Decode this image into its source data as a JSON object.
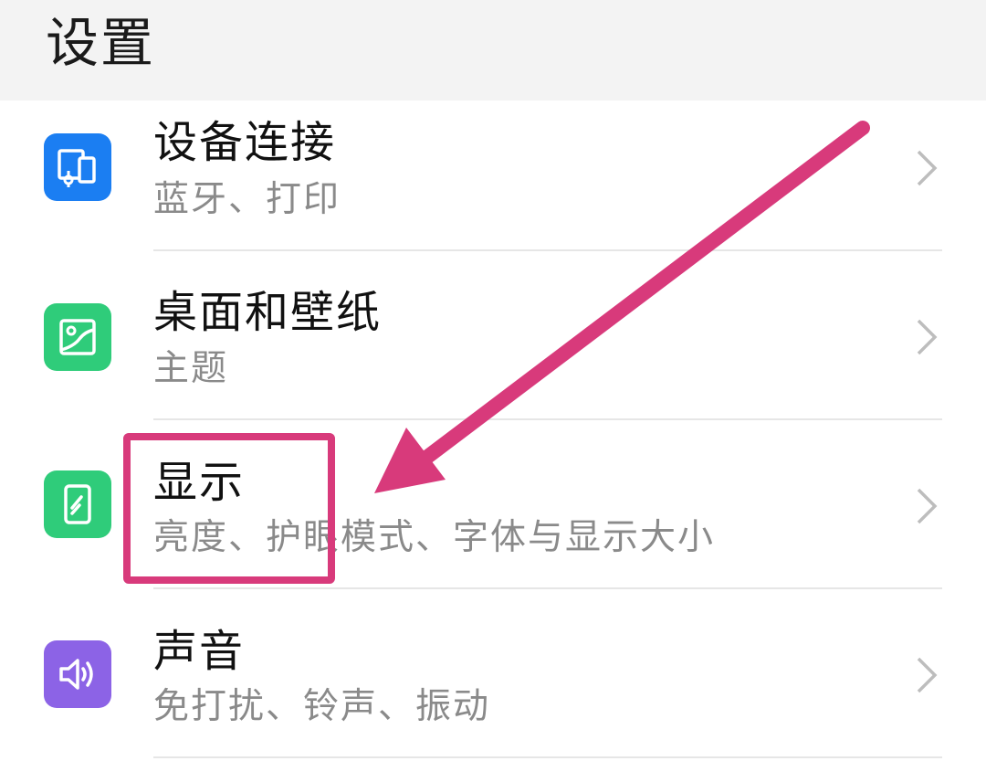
{
  "header": {
    "title": "设置"
  },
  "items": [
    {
      "title": "设备连接",
      "subtitle": "蓝牙、打印",
      "icon": "device-connection-icon",
      "color": "#1b7ef2"
    },
    {
      "title": "桌面和壁纸",
      "subtitle": "主题",
      "icon": "wallpaper-icon",
      "color": "#2fcc7a"
    },
    {
      "title": "显示",
      "subtitle": "亮度、护眼模式、字体与显示大小",
      "icon": "display-icon",
      "color": "#2fcc7a"
    },
    {
      "title": "声音",
      "subtitle": "免打扰、铃声、振动",
      "icon": "sound-icon",
      "color": "#8c63e6"
    }
  ],
  "annotation": {
    "color": "#d83a7b",
    "highlighted_item": "显示"
  }
}
